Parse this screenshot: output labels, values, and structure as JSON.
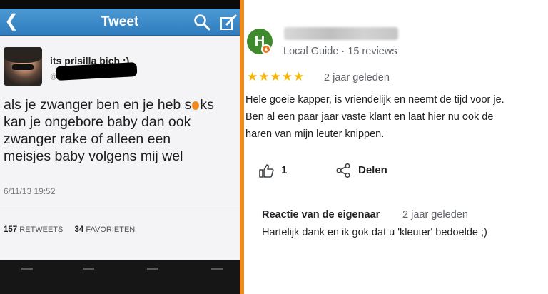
{
  "tweet": {
    "header_title": "Tweet",
    "back_icon": "chevron-left-icon",
    "search_icon": "search-icon",
    "compose_icon": "compose-icon",
    "user_name": "its prisilla bich ;)",
    "handle_prefix": "@",
    "text_lines": [
      "als je zwanger ben en je heb s",
      "ks",
      "kan je ongebore baby dan ook",
      "zwanger rake of alleen een",
      "meisjes baby volgens mij wel"
    ],
    "date": "6/11/13 19:52",
    "retweets_count": "157",
    "retweets_label": "RETWEETS",
    "favorites_count": "34",
    "favorites_label": "FAVORIETEN"
  },
  "review": {
    "avatar_letter": "H",
    "guide_label": "Local Guide · 15 reviews",
    "stars": "★★★★★",
    "rating": 5,
    "date": "2 jaar geleden",
    "text_lines": [
      "Hele goeie kapper, is vriendelijk en neemt de tijd voor je.",
      "Ben al een paar jaar vaste klant en laat hier nu ook de",
      "haren van mijn leuter knippen."
    ],
    "like_count": "1",
    "share_label": "Delen",
    "owner_reply_title": "Reactie van de eigenaar",
    "owner_reply_date": "2 jaar geleden",
    "owner_reply_text": "Hartelijk dank en ik gok dat u 'kleuter' bedoelde ;)"
  },
  "colors": {
    "navbar_blue": "#3a88c8",
    "divider_orange": "#f08a1e",
    "star_gold": "#f4b400",
    "avatar_green": "#3e8a2c"
  }
}
